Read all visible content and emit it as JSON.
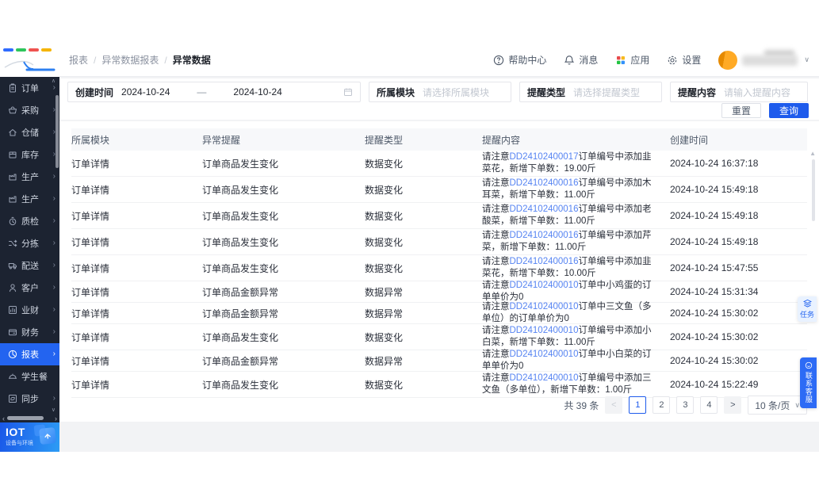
{
  "colors": {
    "accent": "#1e5bec",
    "sidebar_active": "#2364f0",
    "link": "#5684f2",
    "logo_dashes": [
      "#2f6bff",
      "#2ec55b",
      "#ef5350",
      "#f5b400"
    ]
  },
  "sidebar": {
    "items": [
      {
        "key": "orders",
        "label": "订单",
        "icon": "clipboard-icon",
        "active": false,
        "chevron": true
      },
      {
        "key": "purchase",
        "label": "采购",
        "icon": "basket-icon",
        "active": false,
        "chevron": true
      },
      {
        "key": "warehouse",
        "label": "仓储",
        "icon": "house-icon",
        "active": false,
        "chevron": true
      },
      {
        "key": "inventory",
        "label": "库存",
        "icon": "box-icon",
        "active": false,
        "chevron": true
      },
      {
        "key": "production-1",
        "label": "生产",
        "icon": "factory-icon",
        "active": false,
        "chevron": true
      },
      {
        "key": "production-2",
        "label": "生产",
        "icon": "factory-icon",
        "active": false,
        "chevron": true
      },
      {
        "key": "quality",
        "label": "质检",
        "icon": "stopwatch-icon",
        "active": false,
        "chevron": true
      },
      {
        "key": "sorting",
        "label": "分拣",
        "icon": "shuffle-icon",
        "active": false,
        "chevron": true
      },
      {
        "key": "delivery",
        "label": "配送",
        "icon": "truck-icon",
        "active": false,
        "chevron": true
      },
      {
        "key": "customers",
        "label": "客户",
        "icon": "person-icon",
        "active": false,
        "chevron": true
      },
      {
        "key": "biz-finance",
        "label": "业财",
        "icon": "bar-chart-icon",
        "active": false,
        "chevron": true
      },
      {
        "key": "finance",
        "label": "财务",
        "icon": "wallet-icon",
        "active": false,
        "chevron": true
      },
      {
        "key": "reports",
        "label": "报表",
        "icon": "clock-chart-icon",
        "active": true,
        "chevron": true
      },
      {
        "key": "student-meal",
        "label": "学生餐",
        "icon": "meal-icon",
        "active": false,
        "chevron": false
      },
      {
        "key": "sync",
        "label": "同步",
        "icon": "sync-icon",
        "active": false,
        "chevron": true
      }
    ],
    "footer": {
      "title": "IOT",
      "subtitle": "设备与环境"
    }
  },
  "header": {
    "breadcrumb": {
      "0": "报表",
      "1": "异常数据报表",
      "2": "异常数据",
      "separator": "/"
    },
    "help_label": "帮助中心",
    "message_label": "消息",
    "apps_label": "应用",
    "settings_label": "设置"
  },
  "filters": {
    "date": {
      "label": "创建时间",
      "start": "2024-10-24",
      "separator": "—",
      "end": "2024-10-24"
    },
    "module": {
      "label": "所属模块",
      "placeholder": "请选择所属模块"
    },
    "type": {
      "label": "提醒类型",
      "placeholder": "请选择提醒类型"
    },
    "content": {
      "label": "提醒内容",
      "placeholder": "请输入提醒内容"
    },
    "reset_label": "重置",
    "search_label": "查询"
  },
  "table": {
    "columns": [
      "所属模块",
      "异常提醒",
      "提醒类型",
      "提醒内容",
      "创建时间"
    ],
    "rows": [
      {
        "module": "订单详情",
        "alert": "订单商品发生变化",
        "type": "数据变化",
        "pre": "请注意",
        "order": "DD24102400017",
        "rest": "订单编号中添加韭菜花，新增下单数：19.00斤",
        "time": "2024-10-24 16:37:18",
        "lines": 2
      },
      {
        "module": "订单详情",
        "alert": "订单商品发生变化",
        "type": "数据变化",
        "pre": "请注意",
        "order": "DD24102400016",
        "rest": "订单编号中添加木耳菜，新增下单数：11.00斤",
        "time": "2024-10-24 15:49:18",
        "lines": 2
      },
      {
        "module": "订单详情",
        "alert": "订单商品发生变化",
        "type": "数据变化",
        "pre": "请注意",
        "order": "DD24102400016",
        "rest": "订单编号中添加老酸菜，新增下单数：11.00斤",
        "time": "2024-10-24 15:49:18",
        "lines": 2
      },
      {
        "module": "订单详情",
        "alert": "订单商品发生变化",
        "type": "数据变化",
        "pre": "请注意",
        "order": "DD24102400016",
        "rest": "订单编号中添加芹菜，新增下单数：11.00斤",
        "time": "2024-10-24 15:49:18",
        "lines": 2
      },
      {
        "module": "订单详情",
        "alert": "订单商品发生变化",
        "type": "数据变化",
        "pre": "请注意",
        "order": "DD24102400016",
        "rest": "订单编号中添加韭菜花，新增下单数：10.00斤",
        "time": "2024-10-24 15:47:55",
        "lines": 2
      },
      {
        "module": "订单详情",
        "alert": "订单商品金额异常",
        "type": "数据异常",
        "pre": "请注意",
        "order": "DD24102400010",
        "rest": "订单中小鸡蛋的订单单价为0",
        "time": "2024-10-24 15:31:34",
        "lines": 1
      },
      {
        "module": "订单详情",
        "alert": "订单商品金额异常",
        "type": "数据异常",
        "pre": "请注意",
        "order": "DD24102400010",
        "rest": "订单中三文鱼（多单位）的订单单价为0",
        "time": "2024-10-24 15:30:02",
        "lines": 1
      },
      {
        "module": "订单详情",
        "alert": "订单商品发生变化",
        "type": "数据变化",
        "pre": "请注意",
        "order": "DD24102400010",
        "rest": "订单编号中添加小白菜，新增下单数：11.00斤",
        "time": "2024-10-24 15:30:02",
        "lines": 2
      },
      {
        "module": "订单详情",
        "alert": "订单商品金额异常",
        "type": "数据异常",
        "pre": "请注意",
        "order": "DD24102400010",
        "rest": "订单中小白菜的订单单价为0",
        "time": "2024-10-24 15:30:02",
        "lines": 1
      },
      {
        "module": "订单详情",
        "alert": "订单商品发生变化",
        "type": "数据变化",
        "pre": "请注意",
        "order": "DD24102400010",
        "rest": "订单编号中添加三文鱼（多单位），新增下单数：1.00斤",
        "time": "2024-10-24 15:22:49",
        "lines": 2
      }
    ]
  },
  "pagination": {
    "total": "共 39 条",
    "prev": "<",
    "next": ">",
    "pages": [
      "1",
      "2",
      "3",
      "4"
    ],
    "active": "1",
    "size": "10 条/页"
  },
  "floating": {
    "task": "任务",
    "service": "联系客服"
  }
}
